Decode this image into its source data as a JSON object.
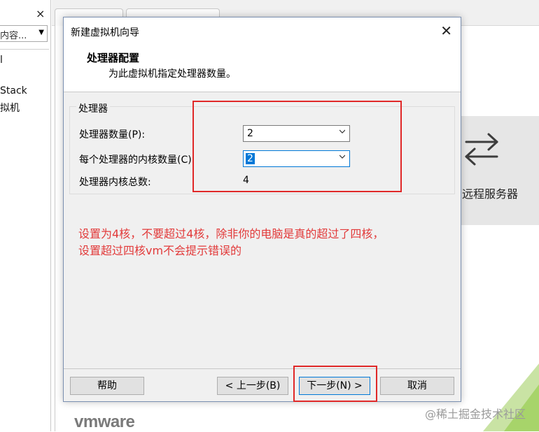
{
  "background": {
    "sidebar_close": "×",
    "search_placeholder": "内容...",
    "tree_items": [
      "l",
      "Stack",
      "拟机"
    ],
    "remote_tile_label": "远程服务器",
    "logo": "vmware",
    "watermark": "@稀土掘金技术社区"
  },
  "dialog": {
    "title": "新建虚拟机向导",
    "close_icon": "close-icon",
    "header_title": "处理器配置",
    "header_subtitle": "为此虚拟机指定处理器数量。",
    "group_label": "处理器",
    "processor_count_label": "处理器数量(P):",
    "processor_count_value": "2",
    "cores_per_processor_label": "每个处理器的内核数量(C):",
    "cores_per_processor_value": "2",
    "total_cores_label": "处理器内核总数:",
    "total_cores_value": "4",
    "note_line1": "设置为4核，不要超过4核，除非你的电脑是真的超过了四核，",
    "note_line2": "设置超过四核vm不会提示错误的",
    "buttons": {
      "help": "帮助",
      "back": "< 上一步(B)",
      "next": "下一步(N) >",
      "cancel": "取消"
    }
  },
  "colors": {
    "annotation_red": "#e02828",
    "note_red": "#e23a3a",
    "focus_blue": "#0078d7"
  }
}
